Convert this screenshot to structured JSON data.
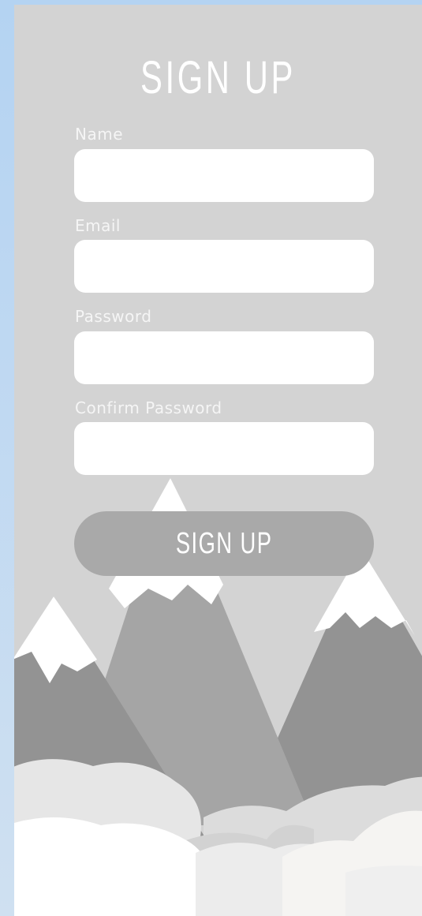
{
  "form": {
    "title": "SIGN UP",
    "fields": [
      {
        "label": "Name",
        "value": "",
        "placeholder": ""
      },
      {
        "label": "Email",
        "value": "",
        "placeholder": ""
      },
      {
        "label": "Password",
        "value": "",
        "placeholder": ""
      },
      {
        "label": "Confirm Password",
        "value": "",
        "placeholder": ""
      }
    ],
    "submit_label": "SIGN UP"
  },
  "colors": {
    "page_background": "#b4d3f2",
    "card_background": "#d3d3d3",
    "input_background": "#ffffff",
    "button_background": "#a9a9a9",
    "text": "#ffffff"
  }
}
